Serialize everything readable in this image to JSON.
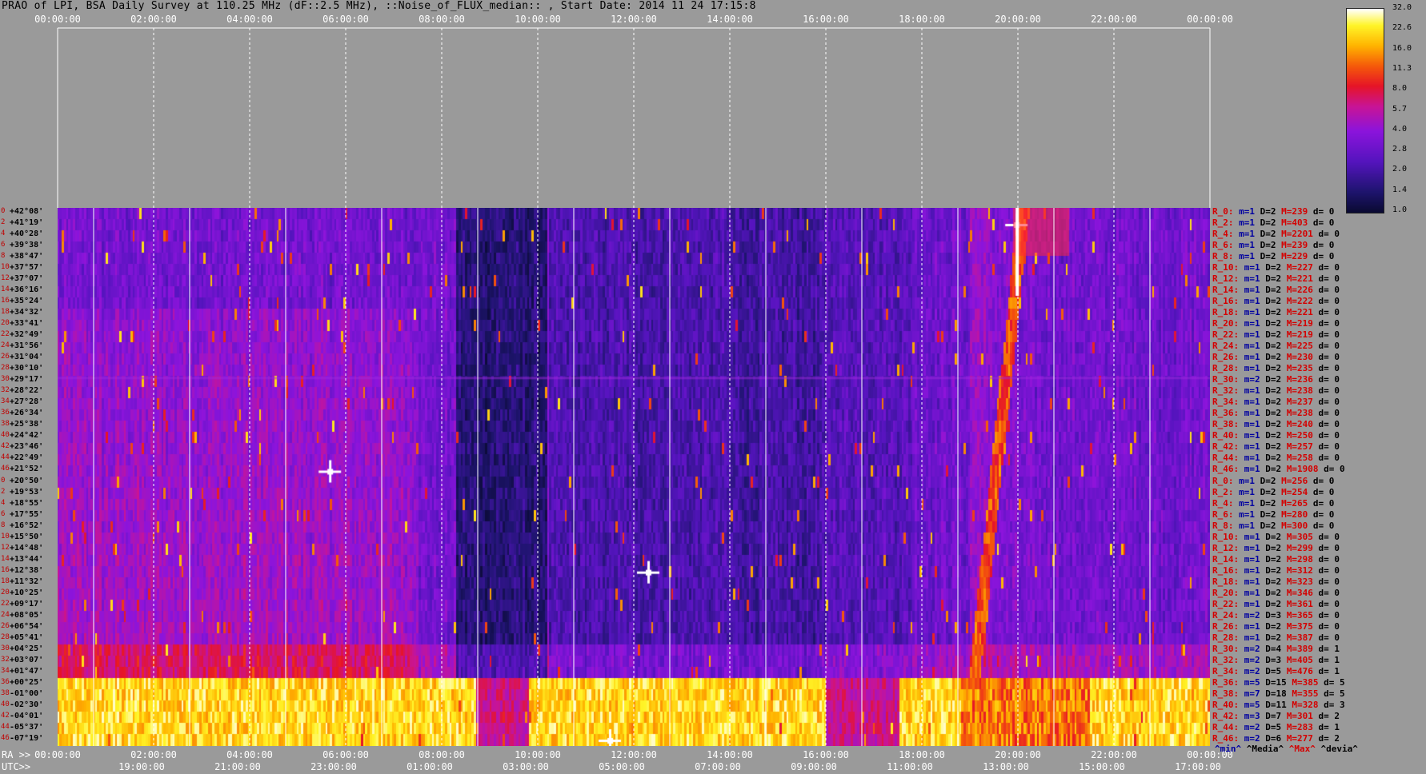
{
  "title": "PRAO of LPI, BSA Daily Survey at 110.25 MHz (dF::2.5 MHz), ::Noise_of_FLUX_median:: , Start Date: 2014 11 24 17:15:8",
  "top_ticks": [
    "00:00:00",
    "02:00:00",
    "04:00:00",
    "06:00:00",
    "08:00:00",
    "10:00:00",
    "12:00:00",
    "14:00:00",
    "16:00:00",
    "18:00:00",
    "20:00:00",
    "22:00:00",
    "00:00:00"
  ],
  "ra_ticks": [
    "00:00:00",
    "02:00:00",
    "04:00:00",
    "06:00:00",
    "08:00:00",
    "10:00:00",
    "12:00:00",
    "14:00:00",
    "16:00:00",
    "18:00:00",
    "20:00:00",
    "22:00:00",
    "00:00:00"
  ],
  "utc_ticks": [
    "19:00:00",
    "21:00:00",
    "23:00:00",
    "01:00:00",
    "03:00:00",
    "05:00:00",
    "07:00:00",
    "09:00:00",
    "11:00:00",
    "13:00:00",
    "15:00:00",
    "17:00:00"
  ],
  "ra_label": "RA >>",
  "utc_label": "UTC>>",
  "legend": {
    "min": "^min^",
    "median": "^Media^",
    "max": "^Max^",
    "dev": "^devia^",
    "colors": {
      "min": "#0000a0",
      "median": "#000000",
      "max": "#d40000",
      "dev": "#000000"
    }
  },
  "colorbar": {
    "ticks": [
      "32.0",
      "22.6",
      "16.0",
      "11.3",
      "8.0",
      "5.7",
      "4.0",
      "2.8",
      "2.0",
      "1.4",
      "1.0"
    ]
  },
  "row_numbers": [
    "0",
    "2",
    "4",
    "6",
    "8",
    "10",
    "12",
    "14",
    "16",
    "18",
    "20",
    "22",
    "24",
    "26",
    "28",
    "30",
    "32",
    "34",
    "36",
    "38",
    "40",
    "42",
    "44",
    "46",
    "0",
    "2",
    "4",
    "6",
    "8",
    "10",
    "12",
    "14",
    "16",
    "18",
    "20",
    "22",
    "24",
    "26",
    "28",
    "30",
    "32",
    "34",
    "36",
    "38",
    "40",
    "42",
    "44",
    "46"
  ],
  "dec_labels": [
    "+42°08'",
    "+41°19'",
    "+40°28'",
    "+39°38'",
    "+38°47'",
    "+37°57'",
    "+37°07'",
    "+36°16'",
    "+35°24'",
    "+34°32'",
    "+33°41'",
    "+32°49'",
    "+31°56'",
    "+31°04'",
    "+30°10'",
    "+29°17'",
    "+28°22'",
    "+27°28'",
    "+26°34'",
    "+25°38'",
    "+24°42'",
    "+23°46'",
    "+22°49'",
    "+21°52'",
    "+20°50'",
    "+19°53'",
    "+18°55'",
    "+17°55'",
    "+16°52'",
    "+15°50'",
    "+14°48'",
    "+13°44'",
    "+12°38'",
    "+11°32'",
    "+10°25'",
    "+09°17'",
    "+08°05'",
    "+06°54'",
    "+05°41'",
    "+04°25'",
    "+03°07'",
    "+01°47'",
    "+00°25'",
    "-01°00'",
    "-02°30'",
    "-04°01'",
    "-05°37'",
    "-07°19'"
  ],
  "row_stats": [
    {
      "r": "R_0:",
      "m": "m=1",
      "D": "D=2",
      "M": "M=239",
      "d": "d= 0"
    },
    {
      "r": "R_2:",
      "m": "m=1",
      "D": "D=2",
      "M": "M=403",
      "d": "d= 0"
    },
    {
      "r": "R_4:",
      "m": "m=1",
      "D": "D=2",
      "M": "M=2201",
      "d": "d= 0"
    },
    {
      "r": "R_6:",
      "m": "m=1",
      "D": "D=2",
      "M": "M=239",
      "d": "d= 0"
    },
    {
      "r": "R_8:",
      "m": "m=1",
      "D": "D=2",
      "M": "M=229",
      "d": "d= 0"
    },
    {
      "r": "R_10:",
      "m": "m=1",
      "D": "D=2",
      "M": "M=227",
      "d": "d= 0"
    },
    {
      "r": "R_12:",
      "m": "m=1",
      "D": "D=2",
      "M": "M=221",
      "d": "d= 0"
    },
    {
      "r": "R_14:",
      "m": "m=1",
      "D": "D=2",
      "M": "M=226",
      "d": "d= 0"
    },
    {
      "r": "R_16:",
      "m": "m=1",
      "D": "D=2",
      "M": "M=222",
      "d": "d= 0"
    },
    {
      "r": "R_18:",
      "m": "m=1",
      "D": "D=2",
      "M": "M=221",
      "d": "d= 0"
    },
    {
      "r": "R_20:",
      "m": "m=1",
      "D": "D=2",
      "M": "M=219",
      "d": "d= 0"
    },
    {
      "r": "R_22:",
      "m": "m=1",
      "D": "D=2",
      "M": "M=219",
      "d": "d= 0"
    },
    {
      "r": "R_24:",
      "m": "m=1",
      "D": "D=2",
      "M": "M=225",
      "d": "d= 0"
    },
    {
      "r": "R_26:",
      "m": "m=1",
      "D": "D=2",
      "M": "M=230",
      "d": "d= 0"
    },
    {
      "r": "R_28:",
      "m": "m=1",
      "D": "D=2",
      "M": "M=235",
      "d": "d= 0"
    },
    {
      "r": "R_30:",
      "m": "m=2",
      "D": "D=2",
      "M": "M=236",
      "d": "d= 0"
    },
    {
      "r": "R_32:",
      "m": "m=1",
      "D": "D=2",
      "M": "M=238",
      "d": "d= 0"
    },
    {
      "r": "R_34:",
      "m": "m=1",
      "D": "D=2",
      "M": "M=237",
      "d": "d= 0"
    },
    {
      "r": "R_36:",
      "m": "m=1",
      "D": "D=2",
      "M": "M=238",
      "d": "d= 0"
    },
    {
      "r": "R_38:",
      "m": "m=1",
      "D": "D=2",
      "M": "M=240",
      "d": "d= 0"
    },
    {
      "r": "R_40:",
      "m": "m=1",
      "D": "D=2",
      "M": "M=250",
      "d": "d= 0"
    },
    {
      "r": "R_42:",
      "m": "m=1",
      "D": "D=2",
      "M": "M=257",
      "d": "d= 0"
    },
    {
      "r": "R_44:",
      "m": "m=1",
      "D": "D=2",
      "M": "M=258",
      "d": "d= 0"
    },
    {
      "r": "R_46:",
      "m": "m=1",
      "D": "D=2",
      "M": "M=1908",
      "d": "d= 0"
    },
    {
      "r": "R_0:",
      "m": "m=1",
      "D": "D=2",
      "M": "M=256",
      "d": "d= 0"
    },
    {
      "r": "R_2:",
      "m": "m=1",
      "D": "D=2",
      "M": "M=254",
      "d": "d= 0"
    },
    {
      "r": "R_4:",
      "m": "m=1",
      "D": "D=2",
      "M": "M=265",
      "d": "d= 0"
    },
    {
      "r": "R_6:",
      "m": "m=1",
      "D": "D=2",
      "M": "M=280",
      "d": "d= 0"
    },
    {
      "r": "R_8:",
      "m": "m=1",
      "D": "D=2",
      "M": "M=300",
      "d": "d= 0"
    },
    {
      "r": "R_10:",
      "m": "m=1",
      "D": "D=2",
      "M": "M=305",
      "d": "d= 0"
    },
    {
      "r": "R_12:",
      "m": "m=1",
      "D": "D=2",
      "M": "M=299",
      "d": "d= 0"
    },
    {
      "r": "R_14:",
      "m": "m=1",
      "D": "D=2",
      "M": "M=298",
      "d": "d= 0"
    },
    {
      "r": "R_16:",
      "m": "m=1",
      "D": "D=2",
      "M": "M=312",
      "d": "d= 0"
    },
    {
      "r": "R_18:",
      "m": "m=1",
      "D": "D=2",
      "M": "M=323",
      "d": "d= 0"
    },
    {
      "r": "R_20:",
      "m": "m=1",
      "D": "D=2",
      "M": "M=346",
      "d": "d= 0"
    },
    {
      "r": "R_22:",
      "m": "m=1",
      "D": "D=2",
      "M": "M=361",
      "d": "d= 0"
    },
    {
      "r": "R_24:",
      "m": "m=2",
      "D": "D=3",
      "M": "M=365",
      "d": "d= 0"
    },
    {
      "r": "R_26:",
      "m": "m=1",
      "D": "D=2",
      "M": "M=375",
      "d": "d= 0"
    },
    {
      "r": "R_28:",
      "m": "m=1",
      "D": "D=2",
      "M": "M=387",
      "d": "d= 0"
    },
    {
      "r": "R_30:",
      "m": "m=2",
      "D": "D=4",
      "M": "M=389",
      "d": "d= 1"
    },
    {
      "r": "R_32:",
      "m": "m=2",
      "D": "D=3",
      "M": "M=405",
      "d": "d= 1"
    },
    {
      "r": "R_34:",
      "m": "m=2",
      "D": "D=5",
      "M": "M=476",
      "d": "d= 1"
    },
    {
      "r": "R_36:",
      "m": "m=5",
      "D": "D=15",
      "M": "M=385",
      "d": "d= 5"
    },
    {
      "r": "R_38:",
      "m": "m=7",
      "D": "D=18",
      "M": "M=355",
      "d": "d= 5"
    },
    {
      "r": "R_40:",
      "m": "m=5",
      "D": "D=11",
      "M": "M=328",
      "d": "d= 3"
    },
    {
      "r": "R_42:",
      "m": "m=3",
      "D": "D=7",
      "M": "M=301",
      "d": "d= 2"
    },
    {
      "r": "R_44:",
      "m": "m=2",
      "D": "D=5",
      "M": "M=283",
      "d": "d= 1"
    },
    {
      "r": "R_46:",
      "m": "m=2",
      "D": "D=6",
      "M": "M=277",
      "d": "d= 2"
    }
  ],
  "chart_data": {
    "type": "heatmap",
    "title": "PRAO of LPI, BSA Daily Survey at 110.25 MHz (dF::2.5 MHz), ::Noise_of_FLUX_median:: , Start Date: 2014 11 24 17:15:8",
    "x_axis": "RA 00:00:00 to 24:00:00 (UTC 17:15:08 to 17:15:08)",
    "y_axis": "Declination +42°08' to -07°19' (48 beams)",
    "colorscale_range": [
      1.0,
      32.0
    ],
    "colorscale": "log",
    "bright_band_rows": [
      42,
      47
    ],
    "sources": [
      {
        "ra_h": 19.97,
        "dec_row": 1,
        "value": 32
      },
      {
        "ra_h": 5.67,
        "dec_row": 23,
        "value": 32
      },
      {
        "ra_h": 12.3,
        "dec_row": 32,
        "value": 32
      },
      {
        "ra_h": 11.5,
        "dec_row": 47,
        "value": 32
      }
    ]
  }
}
